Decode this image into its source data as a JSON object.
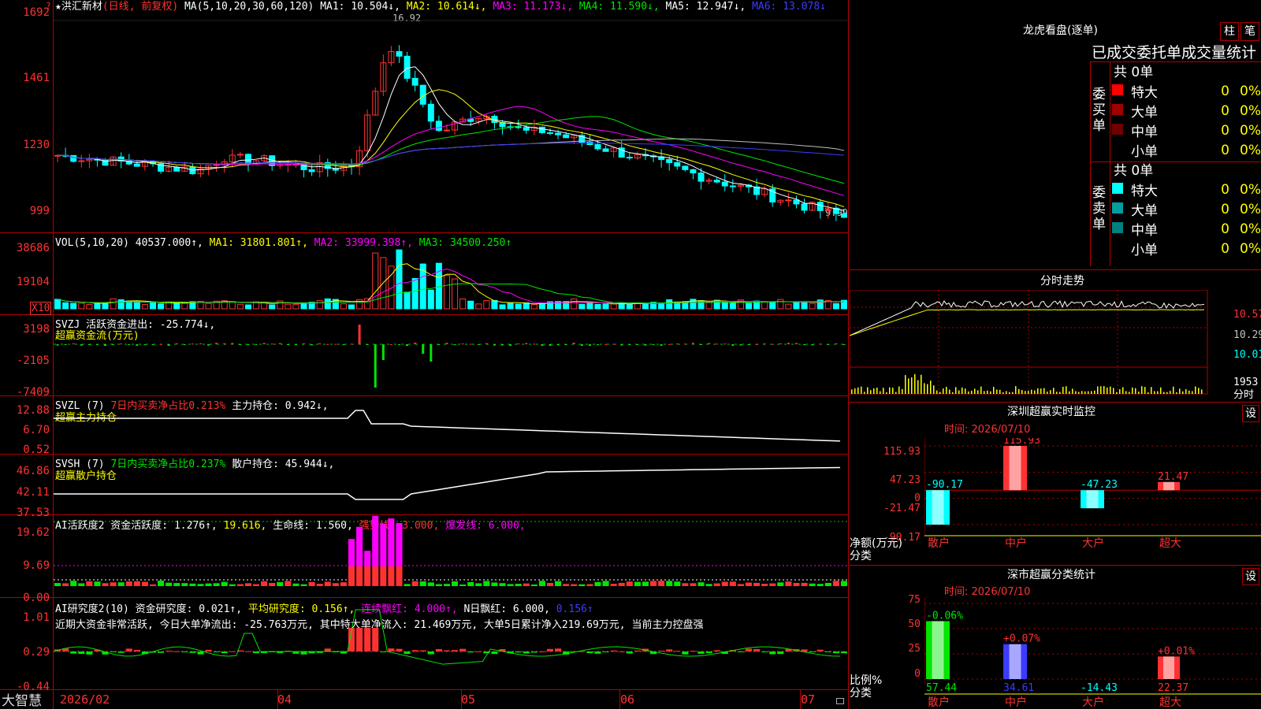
{
  "candle_panel": {
    "star": "★",
    "stock_name": "洪汇新材",
    "period": "(日线, 前复权)",
    "ma_params": "MA(5,10,20,30,60,120)",
    "ma1": "MA1: 10.504↓,",
    "ma2": "MA2: 10.614↓,",
    "ma3": "MA3: 11.173↓,",
    "ma4": "MA4: 11.590↓,",
    "ma5": "MA5: 12.947↓,",
    "ma6": "MA6: 13.078↓",
    "y_ticks": [
      "1692",
      "1461",
      "1230",
      "999"
    ],
    "high_label": "16.92",
    "low_label": "9.99",
    "top_marker": "?"
  },
  "vol_panel": {
    "title": "VOL(5,10,20)",
    "value": "40537.000↑,",
    "ma1": "MA1: 31801.801↑,",
    "ma2": "MA2: 33999.398↑,",
    "ma3": "MA3: 34500.250↑",
    "y_ticks": [
      "38686",
      "19104"
    ],
    "scale": "X10"
  },
  "svzj_panel": {
    "title": "SVZJ  活跃资金进出: -25.774↓,",
    "subtitle": "超赢资金流(万元)",
    "y_ticks": [
      "3198",
      "-2105",
      "-7409"
    ]
  },
  "svzl_panel": {
    "title": "SVZL (7)",
    "ratio": "7日内买卖净占比0.213%",
    "hold": "主力持仓: 0.942↓,",
    "subtitle": "超赢主力持仓",
    "y_ticks": [
      "12.88",
      "6.70",
      "0.52"
    ]
  },
  "svsh_panel": {
    "title": "SVSH (7)",
    "ratio": "7日内买卖净占比0.237%",
    "hold": "散户持仓: 45.944↓,",
    "subtitle": "超赢散户持仓",
    "y_ticks": [
      "46.86",
      "42.11",
      "37.53"
    ]
  },
  "ai_active_panel": {
    "title": "AI活跃度2 资金活跃度: 1.276↑,",
    "v2": "19.616,",
    "life": "生命线: 1.560,",
    "strong": "强势线: 3.000,",
    "burst": "爆发线: 6.000,",
    "y_ticks": [
      "19.62",
      "9.69",
      "0.00"
    ]
  },
  "ai_research_panel": {
    "title": "AI研究度2(10) 资金研究度: 0.021↑,",
    "avg": "平均研究度: 0.156↑,",
    "cont": "连续飘红: 4.000↑,",
    "nday": "N日飘红: 6.000,",
    "last": "0.156↑",
    "message": "近期大资金非常活跃, 今日大单净流出: -25.763万元, 其中特大单净流入: 21.469万元, 大单5日累计净入219.69万元, 当前主力控盘强",
    "y_ticks": [
      "1.01",
      "0.29",
      "-0.44"
    ]
  },
  "x_axis": {
    "labels": [
      "2026/02",
      "04",
      "05",
      "06",
      "07"
    ],
    "logo": "大智慧"
  },
  "dragon_tiger": {
    "title": "龙虎看盘(逐单)",
    "btn_bar": "柱",
    "btn_bi": "笔",
    "heading": "已成交委托单成交量统计",
    "buy_label": "委买单",
    "sell_label": "委卖单",
    "buy_total": "共 0单",
    "sell_total": "共 0单",
    "buy_rows": [
      {
        "label": "特大",
        "count": "0",
        "pct": "0%",
        "color": "#ff0000"
      },
      {
        "label": "大单",
        "count": "0",
        "pct": "0%",
        "color": "#a00000"
      },
      {
        "label": "中单",
        "count": "0",
        "pct": "0%",
        "color": "#6e0000"
      },
      {
        "label": "小单",
        "count": "0",
        "pct": "0%",
        "color": ""
      }
    ],
    "sell_rows": [
      {
        "label": "特大",
        "count": "0",
        "pct": "0%",
        "color": "#00ffff"
      },
      {
        "label": "大单",
        "count": "0",
        "pct": "0%",
        "color": "#00a0a0"
      },
      {
        "label": "中单",
        "count": "0",
        "pct": "0%",
        "color": "#008080"
      },
      {
        "label": "小单",
        "count": "0",
        "pct": "0%",
        "color": ""
      }
    ]
  },
  "intraday": {
    "title": "分时走势",
    "prices": [
      "10.57",
      "10.29",
      "10.01"
    ],
    "vol": "1953",
    "label": "分时"
  },
  "sz_monitor": {
    "title": "深圳超赢实时监控",
    "settings": "设",
    "time": "时间: 2026/07/10",
    "y_ticks": [
      "115.93",
      "47.23",
      "0",
      "-21.47",
      "-90.17"
    ],
    "unit": "净额(万元)",
    "cat_label": "分类",
    "categories": [
      "散户",
      "中户",
      "大户",
      "超大"
    ],
    "values": [
      -90.17,
      115.93,
      -47.23,
      21.47
    ],
    "value_labels": [
      "-90.17",
      "115.93",
      "-47.23",
      "21.47"
    ]
  },
  "sz_class": {
    "title": "深市超赢分类统计",
    "settings": "设",
    "time": "时间: 2026/07/10",
    "y_ticks": [
      "75",
      "50",
      "25",
      "0"
    ],
    "unit": "比例%",
    "cat_label": "分类",
    "categories": [
      "散户",
      "中户",
      "大户",
      "超大"
    ],
    "ratios": [
      57.44,
      34.61,
      -14.43,
      22.37
    ],
    "ratio_labels": [
      "57.44",
      "34.61",
      "-14.43",
      "22.37"
    ],
    "changes": [
      "-0.06%",
      "+0.07%",
      "",
      "+0.01%"
    ]
  },
  "chart_data": [
    {
      "type": "bar",
      "title": "深圳超赢实时监控",
      "categories": [
        "散户",
        "中户",
        "大户",
        "超大"
      ],
      "values": [
        -90.17,
        115.93,
        -47.23,
        21.47
      ],
      "ylabel": "净额(万元)",
      "ylim": [
        -90.17,
        115.93
      ]
    },
    {
      "type": "bar",
      "title": "深市超赢分类统计",
      "categories": [
        "散户",
        "中户",
        "大户",
        "超大"
      ],
      "values": [
        57.44,
        34.61,
        -14.43,
        22.37
      ],
      "ylabel": "比例%",
      "ylim": [
        0,
        75
      ]
    }
  ]
}
